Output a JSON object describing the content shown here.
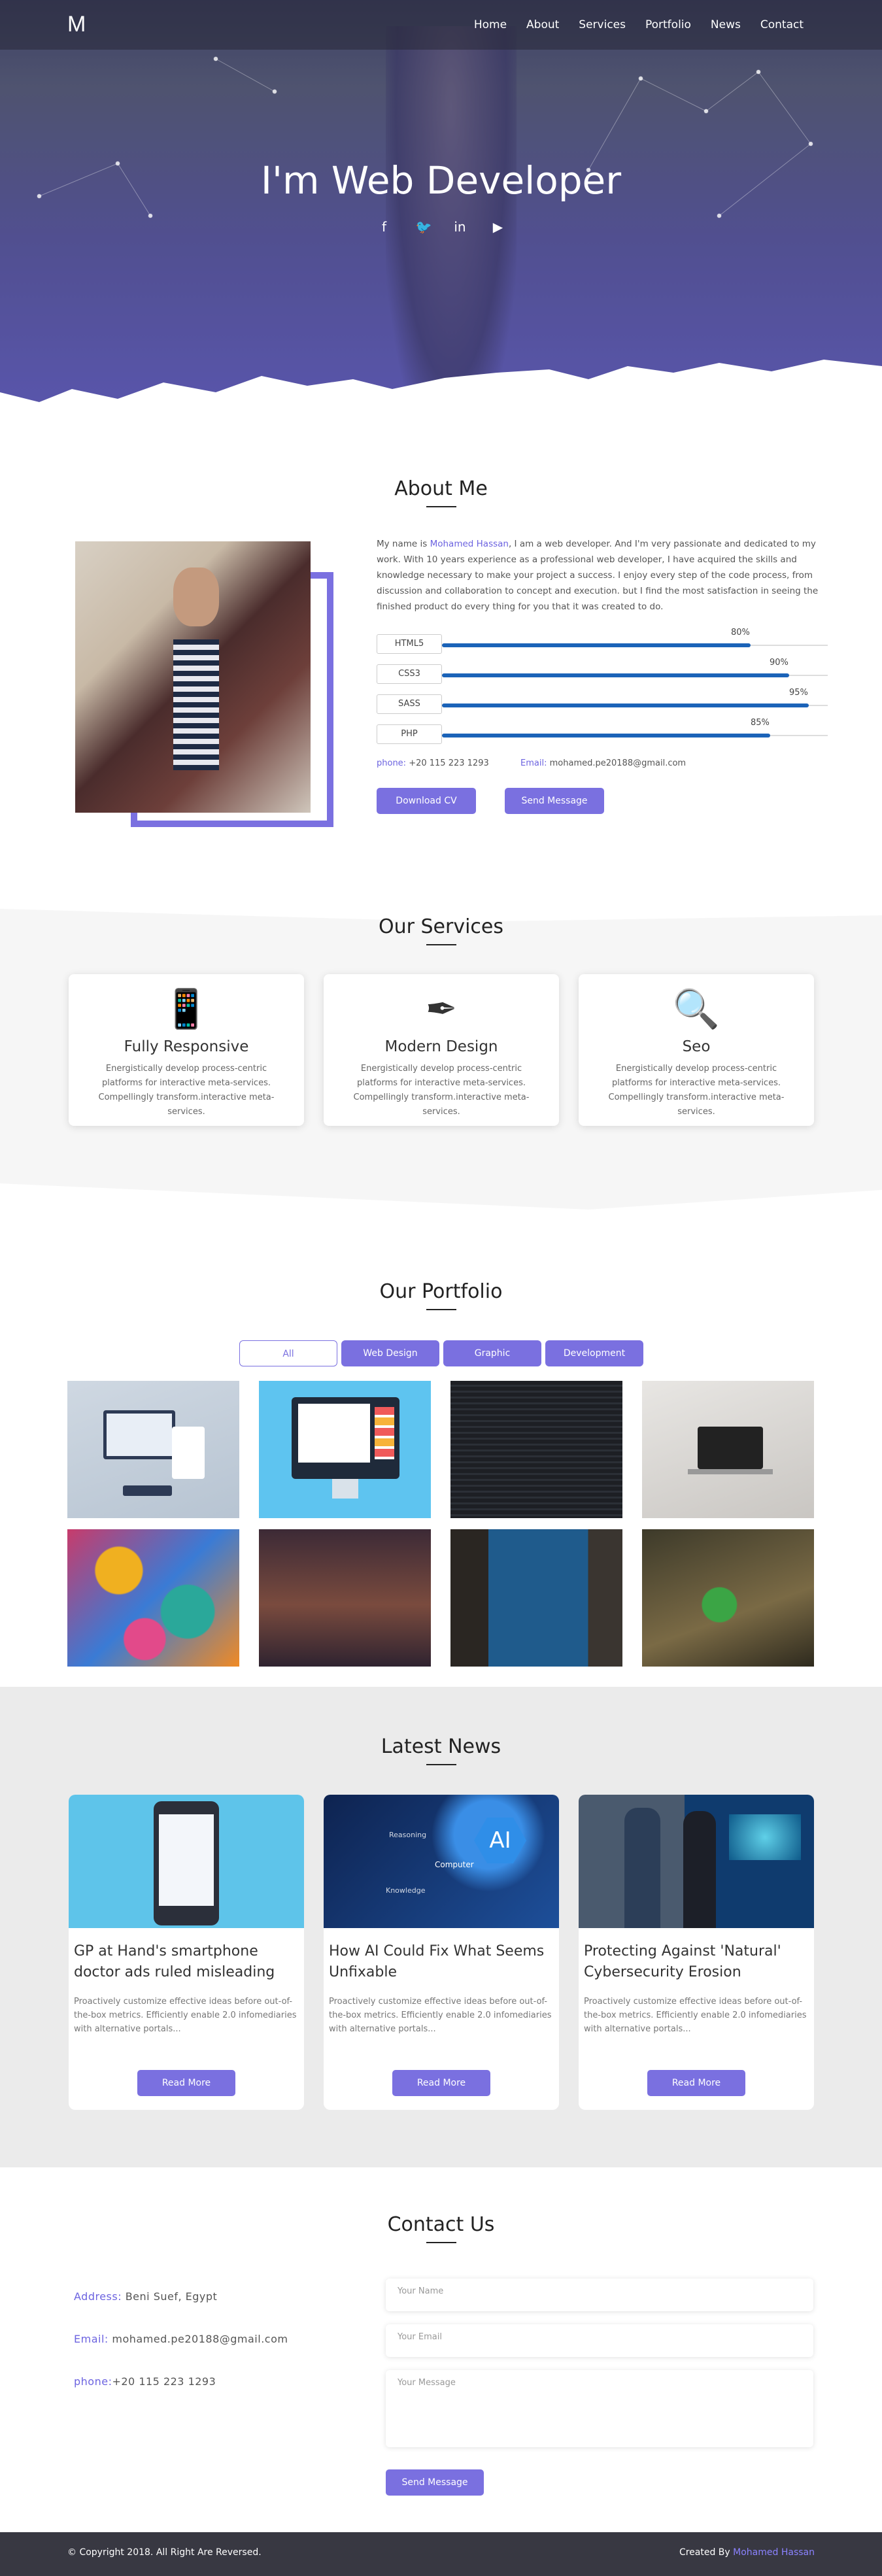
{
  "nav": {
    "logo": "M",
    "items": [
      "Home",
      "About",
      "Services",
      "Portfolio",
      "News",
      "Contact"
    ]
  },
  "hero": {
    "title": "I'm Web Developer",
    "socials": [
      "facebook-icon",
      "twitter-icon",
      "linkedin-icon",
      "youtube-icon"
    ]
  },
  "about": {
    "title": "About Me",
    "text_before": "My name is ",
    "name": "Mohamed Hassan",
    "text_after": ", I am a web developer. And I'm very passionate and dedicated to my work. With 10 years experience as a professional web developer, I have acquired the skills and knowledge necessary to make your project a success. I enjoy every step of the code process, from discussion and collaboration to concept and execution. but I find the most satisfaction in seeing the finished product do every thing for you that it was created to do.",
    "skills": [
      {
        "name": "HTML5",
        "percent": 80,
        "label": "80%"
      },
      {
        "name": "CSS3",
        "percent": 90,
        "label": "90%"
      },
      {
        "name": "SASS",
        "percent": 95,
        "label": "95%"
      },
      {
        "name": "PHP",
        "percent": 85,
        "label": "85%"
      }
    ],
    "phone_label": "phone:",
    "phone": " +20 115 223 1293",
    "email_label": "Email:",
    "email": " mohamed.pe20188@gmail.com",
    "download_label": "Download CV",
    "send_label": "Send Message"
  },
  "services": {
    "title": "Our Services",
    "cards": [
      {
        "icon": "mobile-phone-icon",
        "title": "Fully Responsive",
        "text": "Energistically develop process-centric platforms for interactive meta-services. Compellingly transform.interactive meta-services."
      },
      {
        "icon": "pen-nib-icon",
        "title": "Modern Design",
        "text": "Energistically develop process-centric platforms for interactive meta-services. Compellingly transform.interactive meta-services."
      },
      {
        "icon": "search-icon",
        "title": "Seo",
        "text": "Energistically develop process-centric platforms for interactive meta-services. Compellingly transform.interactive meta-services."
      }
    ]
  },
  "portfolio": {
    "title": "Our Portfolio",
    "filters": [
      "All",
      "Web Design",
      "Graphic",
      "Development"
    ],
    "active_filter": "All"
  },
  "news": {
    "title": "Latest News",
    "cards": [
      {
        "title": "GP at Hand's smartphone doctor ads ruled misleading",
        "text": "Proactively customize effective ideas before out-of-the-box metrics. Efficiently enable 2.0 infomediaries with alternative portals...",
        "button": "Read More"
      },
      {
        "title": "How AI Could Fix What Seems Unfixable",
        "text": "Proactively customize effective ideas before out-of-the-box metrics. Efficiently enable 2.0 infomediaries with alternative portals...",
        "button": "Read More",
        "image_text": [
          "AI",
          "Computer",
          "Reasoning",
          "Knowledge"
        ]
      },
      {
        "title": "Protecting Against 'Natural' Cybersecurity Erosion",
        "text": "Proactively customize effective ideas before out-of-the-box metrics. Efficiently enable 2.0 infomediaries with alternative portals...",
        "button": "Read More"
      }
    ]
  },
  "contact": {
    "title": "Contact Us",
    "address_label": "Address:",
    "address": " Beni Suef, Egypt",
    "email_label": "Email:",
    "email": " mohamed.pe20188@gmail.com",
    "phone_label": "phone:",
    "phone": "+20 115 223 1293",
    "name_placeholder": "Your Name",
    "email_placeholder": "Your Email",
    "message_placeholder": "Your Message",
    "send_label": "Send Message"
  },
  "footer": {
    "copyright": "© Copyright 2018. All Right Are Reversed.",
    "created_by": "Created By ",
    "author": "Mohamed Hassan"
  },
  "colors": {
    "accent": "#7a70e0",
    "skill_bar": "#1b63b8",
    "footer": "#383842"
  }
}
